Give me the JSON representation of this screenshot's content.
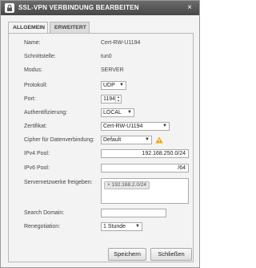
{
  "window": {
    "title": "SSL-VPN VERBINDUNG BEARBEITEN",
    "close_label": "×"
  },
  "tabs": [
    {
      "label": "ALLGEMEIN",
      "active": true
    },
    {
      "label": "ERWEITERT",
      "active": false
    }
  ],
  "form": {
    "name": {
      "label": "Name:",
      "value": "Cert-RW-U1194"
    },
    "schnittstelle": {
      "label": "Schnittstelle:",
      "value": "tun0"
    },
    "modus": {
      "label": "Modus:",
      "value": "SERVER"
    },
    "protokoll": {
      "label": "Protokoll:",
      "value": "UDP"
    },
    "port": {
      "label": "Port:",
      "value": "1194"
    },
    "auth": {
      "label": "Authentifizierung:",
      "value": "LOCAL"
    },
    "zertifikat": {
      "label": "Zertifikat:",
      "value": "Cert-RW-U1194"
    },
    "cipher": {
      "label": "Cipher für Datenverbindung:",
      "value": "Default"
    },
    "ipv4": {
      "label": "IPv4 Pool:",
      "value": "192.168.250.0/24"
    },
    "ipv6": {
      "label": "IPv6 Pool:",
      "value": "/64"
    },
    "servernetze": {
      "label": "Servernetzwerke freigeben:",
      "tags": [
        "192.168.2.0/24"
      ],
      "tag_prefix": "×"
    },
    "search_domain": {
      "label": "Search Domain:",
      "value": ""
    },
    "renegotiation": {
      "label": "Renegotiation:",
      "value": "1 Stunde"
    }
  },
  "buttons": {
    "save": "Speichern",
    "close": "Schließen"
  },
  "colors": {
    "titlebar": "#555555",
    "warning": "#f0a30a"
  }
}
